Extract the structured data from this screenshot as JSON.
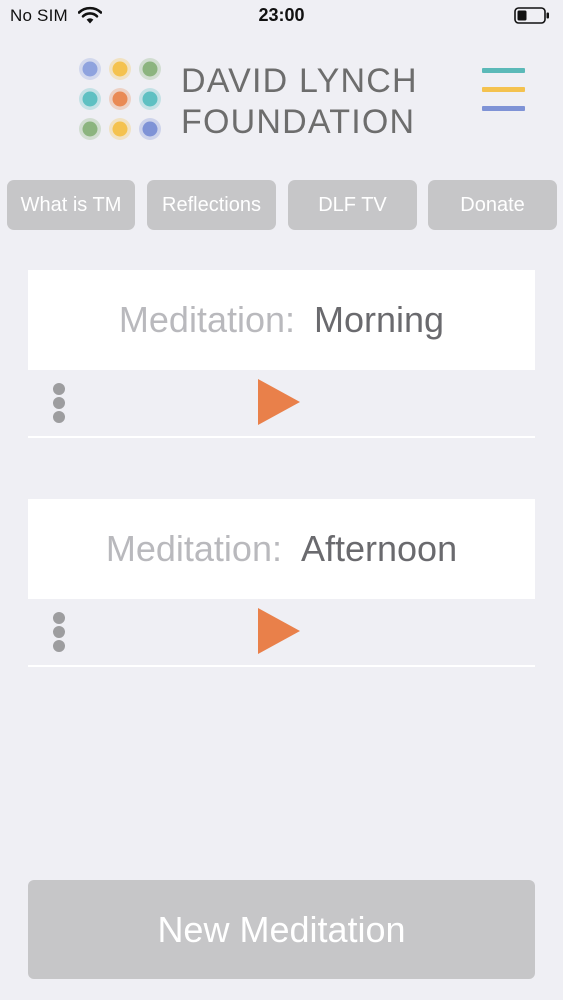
{
  "status_bar": {
    "carrier": "No SIM",
    "time": "23:00",
    "icons": [
      "wifi-icon",
      "battery-icon"
    ]
  },
  "header": {
    "brand_line1": "DAVID LYNCH",
    "brand_line2": "FOUNDATION",
    "logo_dot_colors": [
      "#8fa3de",
      "#f4c24f",
      "#8cb47f",
      "#5fc0c2",
      "#e98a55",
      "#5fc0c2",
      "#8cb47f",
      "#f4c24f",
      "#7f93d6"
    ],
    "menu_icon": "hamburger-menu-icon",
    "menu_colors": [
      "#5bb9b8",
      "#f4c24f",
      "#7f93d6"
    ]
  },
  "nav": [
    {
      "label": "What is TM"
    },
    {
      "label": "Reflections"
    },
    {
      "label": "DLF TV"
    },
    {
      "label": "Donate"
    }
  ],
  "meditations": [
    {
      "label": "Meditation:",
      "value": "Morning"
    },
    {
      "label": "Meditation:",
      "value": "Afternoon"
    }
  ],
  "actions": {
    "new_meditation": "New Meditation"
  },
  "colors": {
    "background": "#efeff4",
    "button_gray": "#c6c6c8",
    "accent_orange": "#e9804a",
    "dots_gray": "#9d9d9f"
  }
}
